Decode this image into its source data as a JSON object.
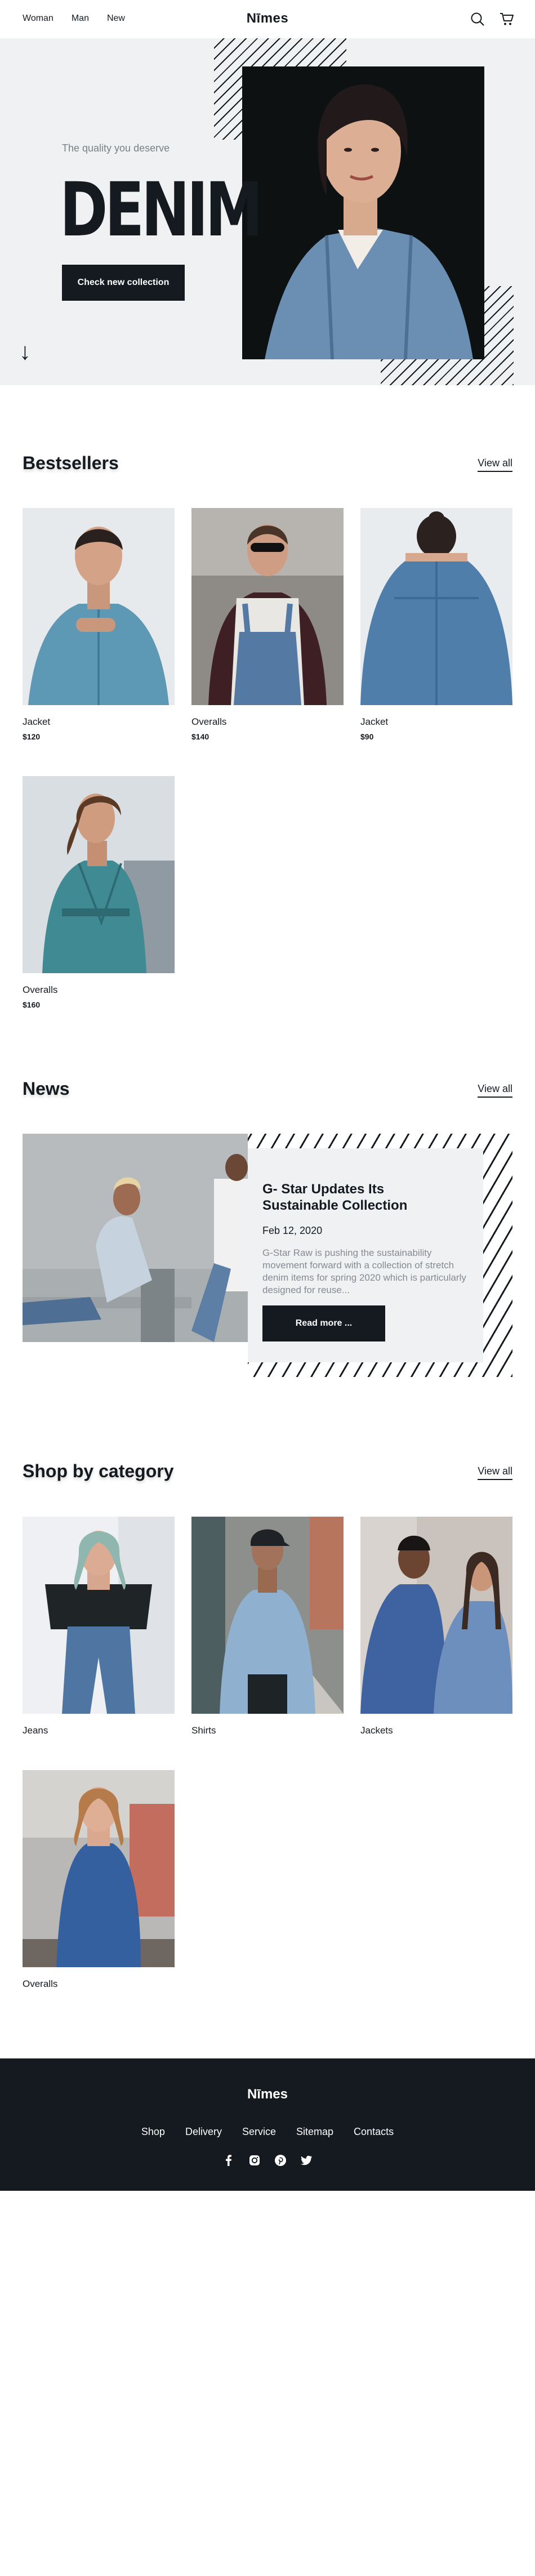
{
  "nav": {
    "links": [
      "Woman",
      "Man",
      "New"
    ],
    "logo": "Nīmes",
    "icons": [
      "search-icon",
      "cart-icon"
    ]
  },
  "hero": {
    "tagline": "The quality you deserve",
    "title": "DENIM",
    "button": "Check new collection",
    "arrow": "↓"
  },
  "bestsellers": {
    "title": "Bestsellers",
    "view_all": "View all",
    "items": [
      {
        "name": "Jacket",
        "price": "$120"
      },
      {
        "name": "Overalls",
        "price": "$140"
      },
      {
        "name": "Jacket",
        "price": "$90"
      },
      {
        "name": "Overalls",
        "price": "$160"
      }
    ]
  },
  "news": {
    "title": "News",
    "view_all": "View all",
    "article": {
      "headline": "G- Star Updates Its Sustainable Collection",
      "date": "Feb 12, 2020",
      "excerpt": "G-Star Raw is pushing the sustainability movement forward with a collection of stretch denim items for spring 2020 which is particularly designed for reuse...",
      "button": "Read more ..."
    }
  },
  "categories": {
    "title": "Shop by category",
    "view_all": "View all",
    "items": [
      "Jeans",
      "Shirts",
      "Jackets",
      "Overalls"
    ]
  },
  "footer": {
    "logo": "Nīmes",
    "links": [
      "Shop",
      "Delivery",
      "Service",
      "Sitemap",
      "Contacts"
    ],
    "social": [
      "facebook-icon",
      "instagram-icon",
      "pinterest-icon",
      "twitter-icon"
    ]
  },
  "colors": {
    "dark": "#141a20",
    "hero_bg": "#eff1f3",
    "muted_text": "#858b92",
    "denim": "#5a8fb6"
  }
}
